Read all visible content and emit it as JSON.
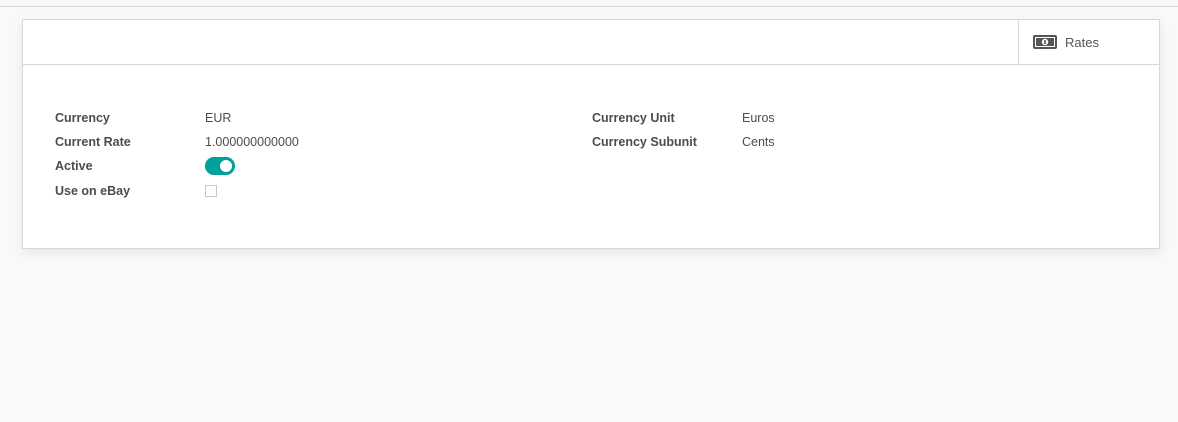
{
  "button_box": {
    "rates_button": {
      "label": "Rates",
      "icon": "money-icon"
    }
  },
  "form": {
    "left_group": {
      "currency": {
        "label": "Currency",
        "value": "EUR"
      },
      "current_rate": {
        "label": "Current Rate",
        "value": "1.000000000000"
      },
      "active": {
        "label": "Active",
        "value": true
      },
      "use_on_ebay": {
        "label": "Use on eBay",
        "value": false
      }
    },
    "right_group": {
      "currency_unit": {
        "label": "Currency Unit",
        "value": "Euros"
      },
      "currency_subunit": {
        "label": "Currency Subunit",
        "value": "Cents"
      }
    }
  },
  "colors": {
    "accent": "#00a09d",
    "background": "#f9f9f9",
    "text": "#4c4c4c"
  }
}
